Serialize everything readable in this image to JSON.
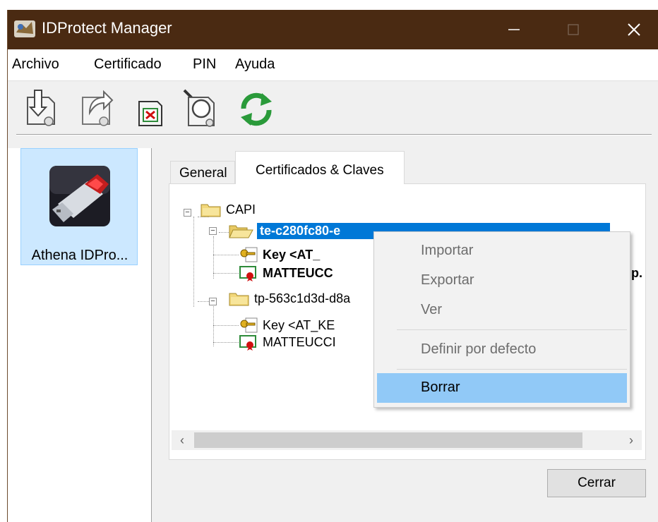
{
  "window": {
    "title": "IDProtect Manager",
    "titlebar_color": "#4a2a12"
  },
  "menubar": [
    "Archivo",
    "Certificado",
    "PIN",
    "Ayuda"
  ],
  "toolbar": {
    "icons": [
      "import-certificate-icon",
      "export-certificate-icon",
      "delete-certificate-icon",
      "view-certificate-icon",
      "refresh-icon"
    ]
  },
  "device": {
    "label": "Athena IDPro...",
    "icon": "usb-token-icon"
  },
  "tabs": [
    {
      "label": "General",
      "active": false
    },
    {
      "label": "Certificados & Claves",
      "active": true
    }
  ],
  "tree": {
    "root": "CAPI",
    "container1": "te-c280fc80-e",
    "container1_key": "Key  <AT_",
    "container1_cert": "MATTEUCC",
    "container2": "tp-563c1d3d-d8a",
    "container2_key": "Key  <AT_KE",
    "container2_cert": "MATTEUCCI",
    "overflow_text": "p."
  },
  "context_menu": {
    "items": [
      {
        "label": "Importar",
        "enabled": false
      },
      {
        "label": "Exportar",
        "enabled": false
      },
      {
        "label": "Ver",
        "enabled": false
      },
      {
        "label": "Definir por defecto",
        "enabled": false
      },
      {
        "label": "Borrar",
        "enabled": true,
        "highlighted": true
      }
    ]
  },
  "buttons": {
    "close": "Cerrar"
  },
  "colors": {
    "selection": "#0078d7",
    "menu_highlight": "#91c9f7",
    "device_tile": "#cce8ff"
  }
}
